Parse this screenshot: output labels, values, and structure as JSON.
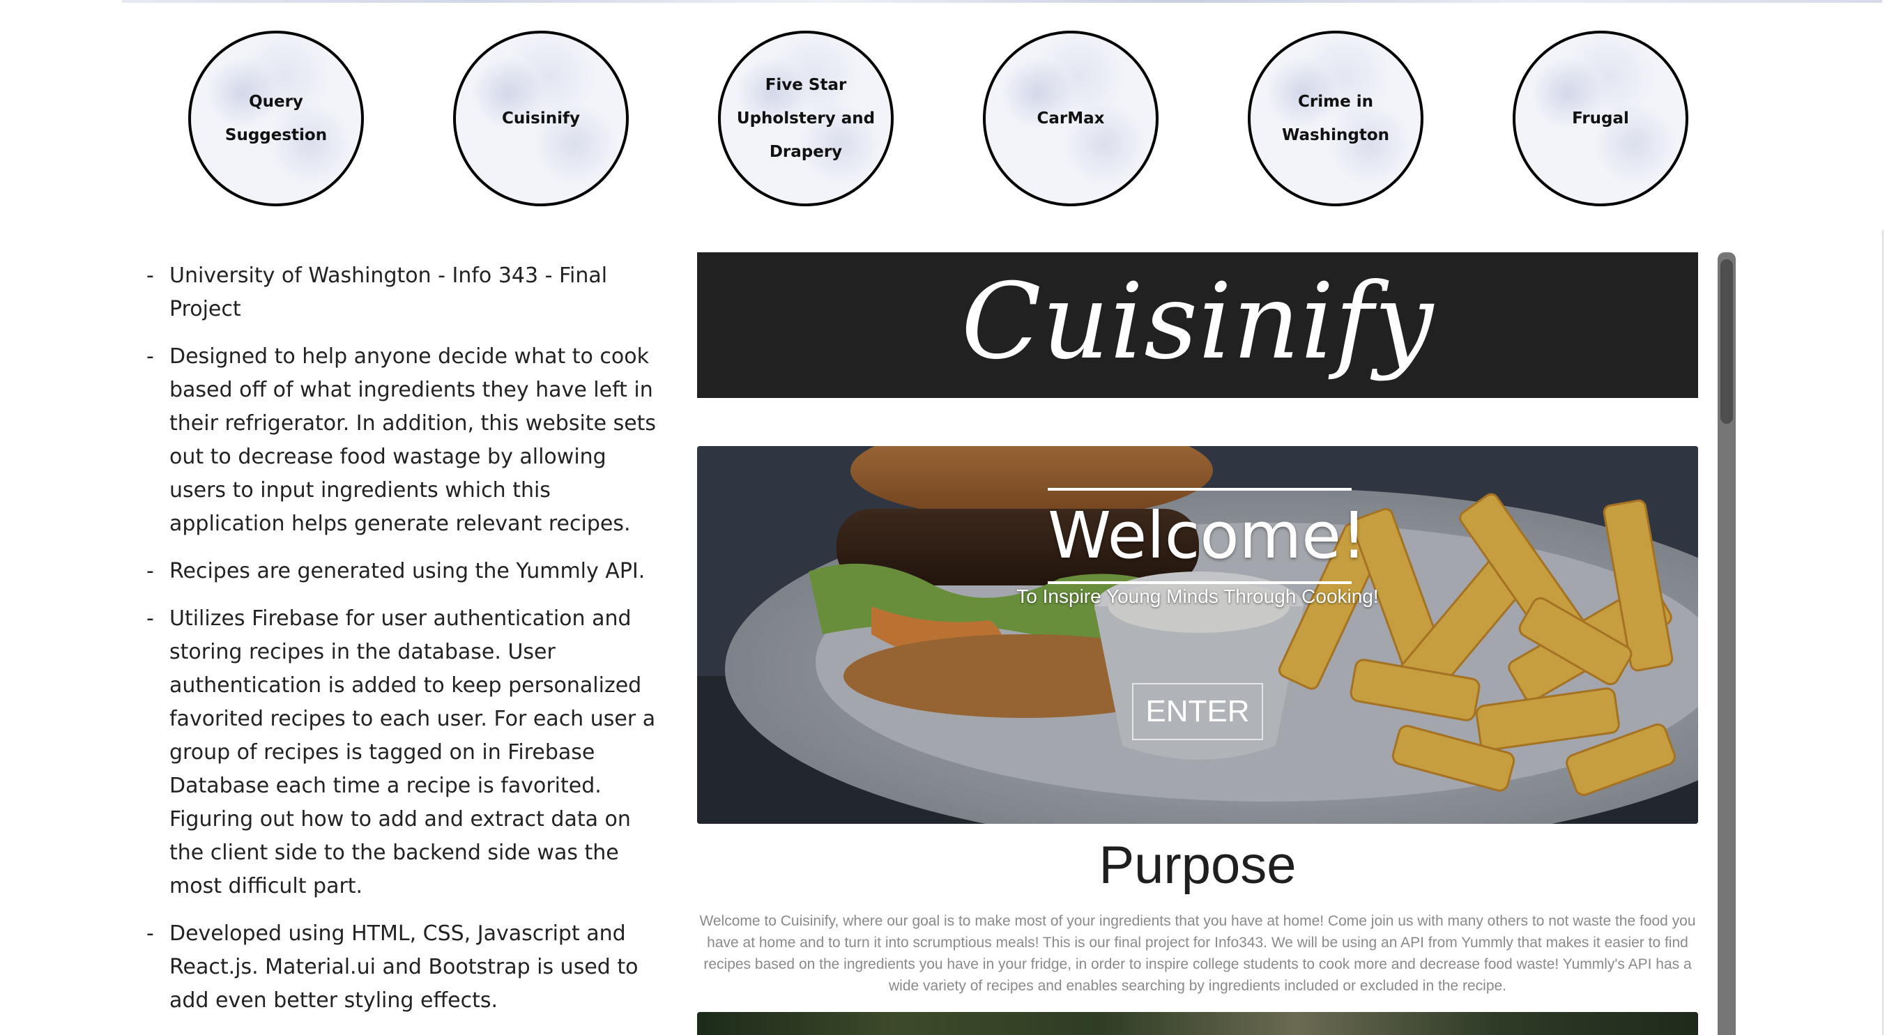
{
  "projects": [
    {
      "label": "Query Suggestion"
    },
    {
      "label": "Cuisinify"
    },
    {
      "label": "Five Star Upholstery and Drapery"
    },
    {
      "label": "CarMax"
    },
    {
      "label": "Crime in Washington"
    },
    {
      "label": "Frugal"
    }
  ],
  "description": {
    "bullet": "-",
    "items": [
      "University of Washington - Info 343 - Final Project",
      "Designed to help anyone decide what to cook based off of what ingredients they have left in their refrigerator. In addition, this website sets out to decrease food wastage by allowing users to input ingredients which this application helps generate relevant recipes.",
      "Recipes are generated using the Yummly API.",
      "Utilizes Firebase for user authentication and storing recipes in the database. User authentication is added to keep personalized favorited recipes to each user. For each user a group of recipes is tagged on in Firebase Database each time a recipe is favorited. Figuring out how to add and extract data on the client side to the backend side was the most difficult part.",
      "Developed using HTML, CSS, Javascript and React.js. Material.ui and Bootstrap is used to add even better styling effects."
    ]
  },
  "preview": {
    "brand": "Cuisinify",
    "hero": {
      "title": "Welcome!",
      "subtitle": "To Inspire Young Minds Through Cooking!",
      "enter_label": "ENTER"
    },
    "purpose": {
      "title": "Purpose",
      "text": "Welcome to Cuisinify, where our goal is to make most of your ingredients that you have at home! Come join us with many others to not waste the food you have at home and to turn it into scrumptious meals! This is our final project for Info343. We will be using an API from Yummly that makes it easier to find recipes based on the ingredients you have in your fridge, in order to inspire college students to cook more and decrease food waste! Yummly's API has a wide variety of recipes and enables searching by ingredients included or excluded in the recipe."
    }
  },
  "colors": {
    "brand_bar": "#212121",
    "circle_border": "#000000",
    "purpose_text": "#8a8a8a",
    "scrollbar": "#767676"
  }
}
